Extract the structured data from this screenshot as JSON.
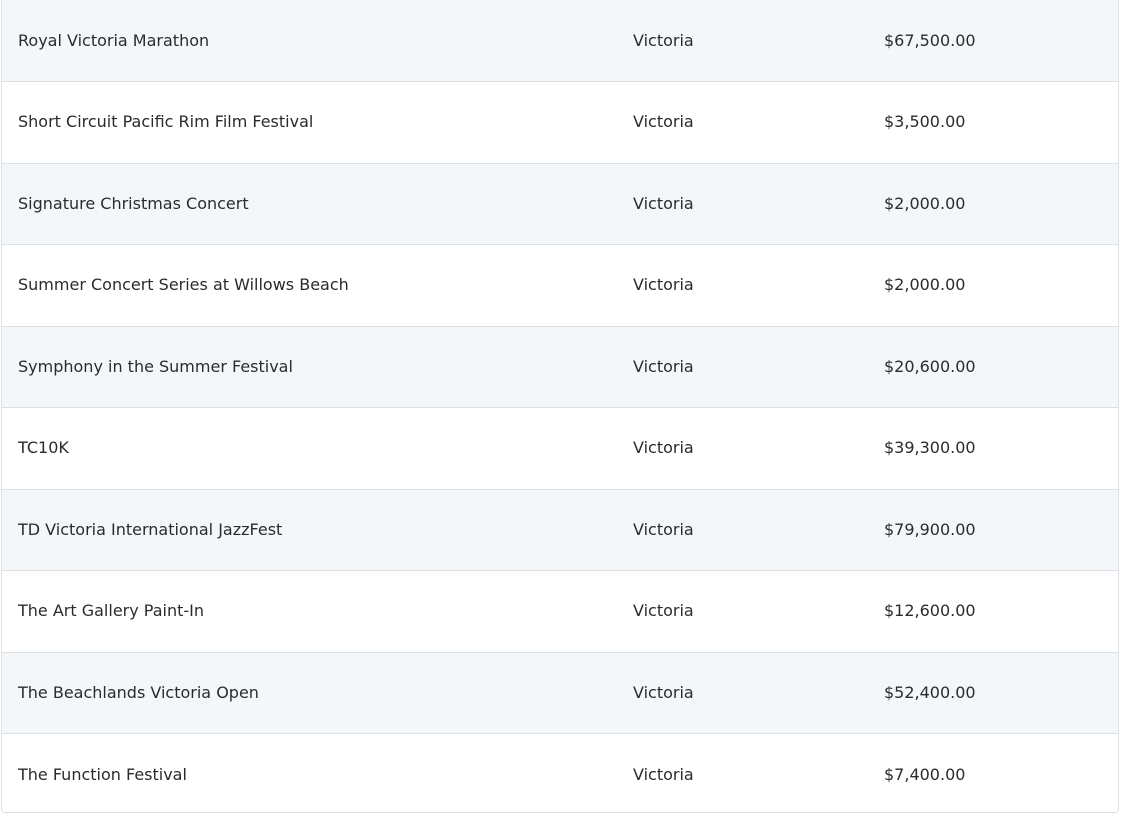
{
  "table": {
    "rows": [
      {
        "name": "Royal Victoria Marathon",
        "city": "Victoria",
        "amount": "$67,500.00"
      },
      {
        "name": "Short Circuit Pacific Rim Film Festival",
        "city": "Victoria",
        "amount": "$3,500.00"
      },
      {
        "name": "Signature Christmas Concert",
        "city": "Victoria",
        "amount": "$2,000.00"
      },
      {
        "name": "Summer Concert Series at Willows Beach",
        "city": "Victoria",
        "amount": "$2,000.00"
      },
      {
        "name": "Symphony in the Summer Festival",
        "city": "Victoria",
        "amount": "$20,600.00"
      },
      {
        "name": "TC10K",
        "city": "Victoria",
        "amount": "$39,300.00"
      },
      {
        "name": "TD Victoria International JazzFest",
        "city": "Victoria",
        "amount": "$79,900.00"
      },
      {
        "name": "The Art Gallery Paint-In",
        "city": "Victoria",
        "amount": "$12,600.00"
      },
      {
        "name": "The Beachlands Victoria Open",
        "city": "Victoria",
        "amount": "$52,400.00"
      },
      {
        "name": "The Function Festival",
        "city": "Victoria",
        "amount": "$7,400.00"
      }
    ]
  },
  "colors": {
    "row_alt": "#f4f7fa",
    "row": "#ffffff",
    "border": "#dcdfe3",
    "text": "#2b2b2b"
  }
}
